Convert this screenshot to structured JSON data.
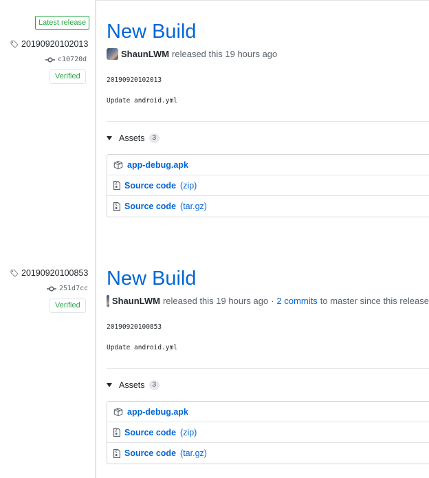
{
  "sidebar": {
    "latest_badge": "Latest release",
    "releases": [
      {
        "tag": "20190920102013",
        "commit": "c10720d",
        "verified": "Verified"
      },
      {
        "tag": "20190920100853",
        "commit": "251d7cc",
        "verified": "Verified"
      }
    ]
  },
  "releases": [
    {
      "title": "New Build",
      "author": "ShaunLWM",
      "released": "released this 19 hours ago",
      "commits_prefix": "",
      "commits_link": "",
      "commits_suffix": "",
      "body_line1": "20190920102013",
      "body_line2": "Update android.yml",
      "assets_label": "Assets",
      "assets_count": "3",
      "assets": [
        {
          "name": "app-debug.apk"
        },
        {
          "name": "Source code",
          "ext": "(zip)"
        },
        {
          "name": "Source code",
          "ext": "(tar.gz)"
        }
      ]
    },
    {
      "title": "New Build",
      "author": "ShaunLWM",
      "released": "released this 19 hours ago",
      "commits_prefix": "·",
      "commits_link": "2 commits",
      "commits_suffix": "to master since this release",
      "body_line1": "20190920100853",
      "body_line2": "Update android.yml",
      "assets_label": "Assets",
      "assets_count": "3",
      "assets": [
        {
          "name": "app-debug.apk"
        },
        {
          "name": "Source code",
          "ext": "(zip)"
        },
        {
          "name": "Source code",
          "ext": "(tar.gz)"
        }
      ]
    }
  ],
  "icons": {
    "tag": "tag-icon",
    "commit": "git-commit-icon",
    "package": "package-icon",
    "zip": "file-zip-icon",
    "caret": "triangle-down-icon"
  },
  "colors": {
    "link": "#0366d6",
    "verified": "#28a745",
    "border": "#e1e4e8"
  }
}
